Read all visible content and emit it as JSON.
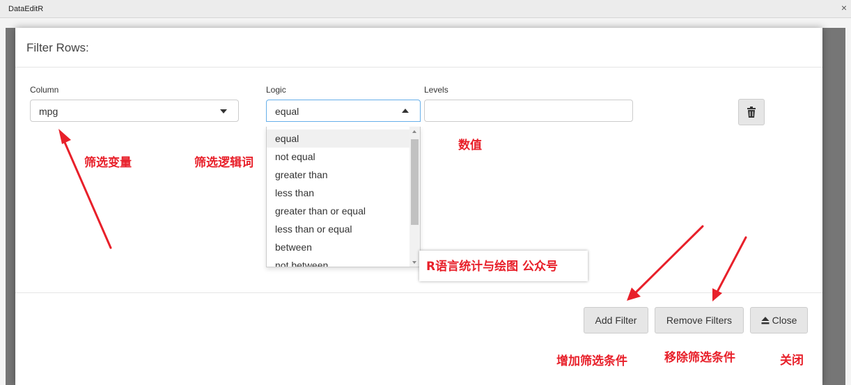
{
  "window": {
    "title": "DataEditR",
    "close_glyph": "×"
  },
  "modal": {
    "title": "Filter Rows:",
    "column": {
      "label": "Column",
      "value": "mpg"
    },
    "logic": {
      "label": "Logic",
      "value": "equal",
      "options": [
        "equal",
        "not equal",
        "greater than",
        "less than",
        "greater than or equal",
        "less than or equal",
        "between",
        "not between"
      ],
      "highlighted": "equal"
    },
    "levels": {
      "label": "Levels",
      "value": ""
    },
    "buttons": {
      "add_filter": "Add Filter",
      "remove_filters": "Remove Filters",
      "close": "Close"
    }
  },
  "annotations": {
    "column": "筛选变量",
    "logic": "筛选逻辑词",
    "levels": "数值",
    "add_filter": "增加筛选条件",
    "remove_filters": "移除筛选条件",
    "close": "关闭",
    "watermark": "R语言统计与绘图 公众号"
  },
  "colors": {
    "annotation": "#e8202a",
    "focus_border": "#66afe9",
    "button_bg": "#e6e6e6"
  },
  "icons": [
    "close-icon",
    "caret-down-icon",
    "caret-up-icon",
    "trash-icon",
    "eject-icon"
  ]
}
